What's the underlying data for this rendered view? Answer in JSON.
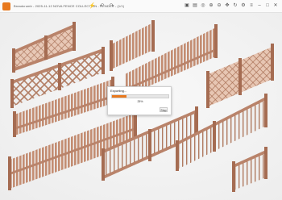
{
  "window": {
    "title": "Breadcrumb - 2025-11-12 NOVA FENCE COLLECTION - RENDER - (1/1)",
    "app_icon": "app-logo-icon"
  },
  "toolbar": {
    "icons": [
      "lightning-icon",
      "undo-icon",
      "redo-icon"
    ]
  },
  "window_controls": {
    "icons": [
      "save-icon",
      "image-icon",
      "fit-icon",
      "zoom-in-icon",
      "zoom-out-icon",
      "pan-icon",
      "rotate-icon",
      "settings-icon",
      "menu-icon",
      "minimize-icon",
      "maximize-icon",
      "close-icon"
    ]
  },
  "dialog": {
    "title": "Exporting...",
    "progress_percent": 25,
    "progress_text": "25%",
    "button_label": "Stop"
  },
  "colors": {
    "accent": "#e8791e",
    "fence_wood": "#c9957a",
    "fence_shadow": "#8a5a44"
  }
}
